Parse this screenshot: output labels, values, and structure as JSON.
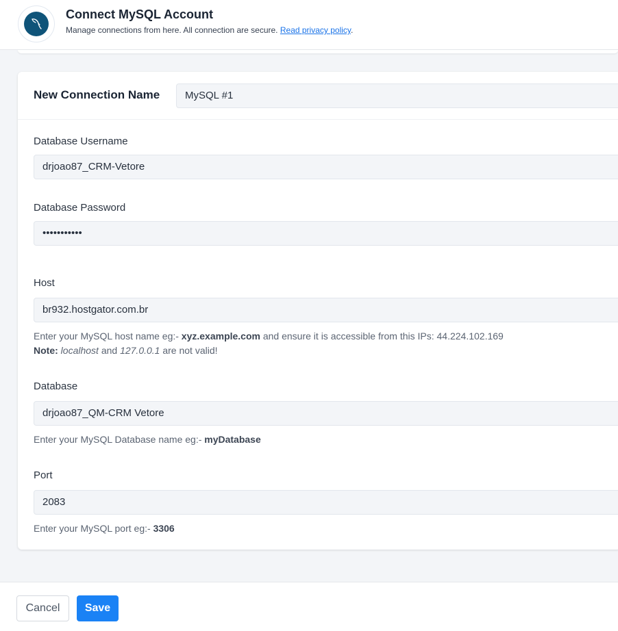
{
  "header": {
    "title": "Connect MySQL Account",
    "subtitle": "Manage connections from here. All connection are secure.",
    "privacy_link": "Read privacy policy",
    "subtitle_end": ".",
    "logo_icon": "mysql-dolphin-icon",
    "logo_color": "#0f5479"
  },
  "form": {
    "connection_name_label": "New Connection Name",
    "connection_name_value": "MySQL #1",
    "username_label": "Database Username",
    "username_value": "drjoao87_CRM-Vetore",
    "password_label": "Database Password",
    "password_value": "•••••••••••",
    "host_label": "Host",
    "host_value": "br932.hostgator.com.br",
    "host_hint": {
      "prefix": "Enter your MySQL host name eg:- ",
      "example": "xyz.example.com",
      "middle": " and ensure it is accessible from this IPs: 44.224.102.169",
      "note_label": "Note:",
      "note_localhost": "localhost",
      "note_and": " and ",
      "note_ip": "127.0.0.1",
      "note_end": " are not valid!"
    },
    "database_label": "Database",
    "database_value": "drjoao87_QM-CRM Vetore",
    "database_hint": {
      "prefix": "Enter your MySQL Database name eg:- ",
      "example": "myDatabase"
    },
    "port_label": "Port",
    "port_value": "2083",
    "port_hint": {
      "prefix": "Enter your MySQL port eg:- ",
      "example": "3306"
    }
  },
  "footer": {
    "cancel_label": "Cancel",
    "save_label": "Save",
    "save_color": "#1a82f5"
  }
}
